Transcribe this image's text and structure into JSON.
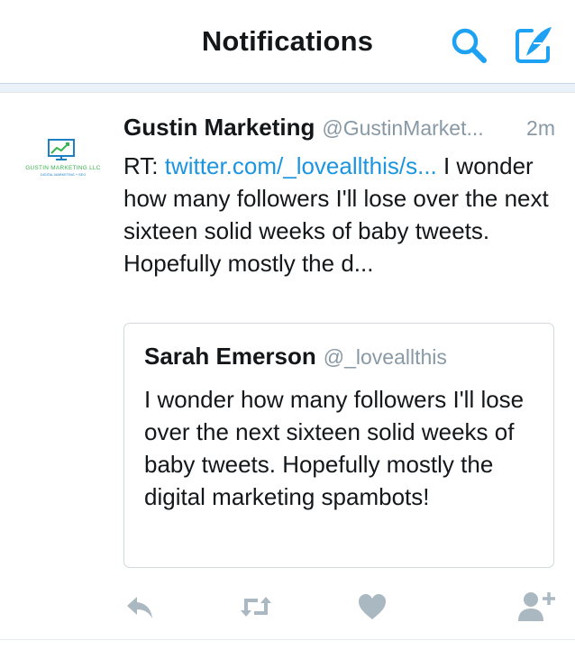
{
  "header": {
    "title": "Notifications",
    "accent_color": "#1da1f2",
    "search_icon": "search-icon",
    "compose_icon": "compose-tweet-icon"
  },
  "tweet": {
    "display_name": "Gustin Marketing",
    "handle": "@GustinMarket...",
    "time": "2m",
    "text_prefix": "RT: ",
    "link": "twitter.com/_loveallthis/s...",
    "text_rest": " I wonder how many followers I'll lose over the next sixteen solid weeks of baby tweets. Hopefully mostly the d...",
    "avatar": {
      "line1": "GUSTIN MARKETING LLC",
      "line2": "DIGITAL MARKETING + SEO"
    },
    "quoted": {
      "display_name": "Sarah Emerson",
      "handle": "@_loveallthis",
      "text": "I wonder how many followers I'll lose over the next sixteen solid weeks of baby tweets. Hopefully mostly the digital marketing spambots!"
    },
    "actions": [
      {
        "icon": "reply-icon"
      },
      {
        "icon": "retweet-icon"
      },
      {
        "icon": "heart-icon"
      },
      {
        "icon": "follow-icon"
      }
    ],
    "action_color": "#aab8c2"
  }
}
